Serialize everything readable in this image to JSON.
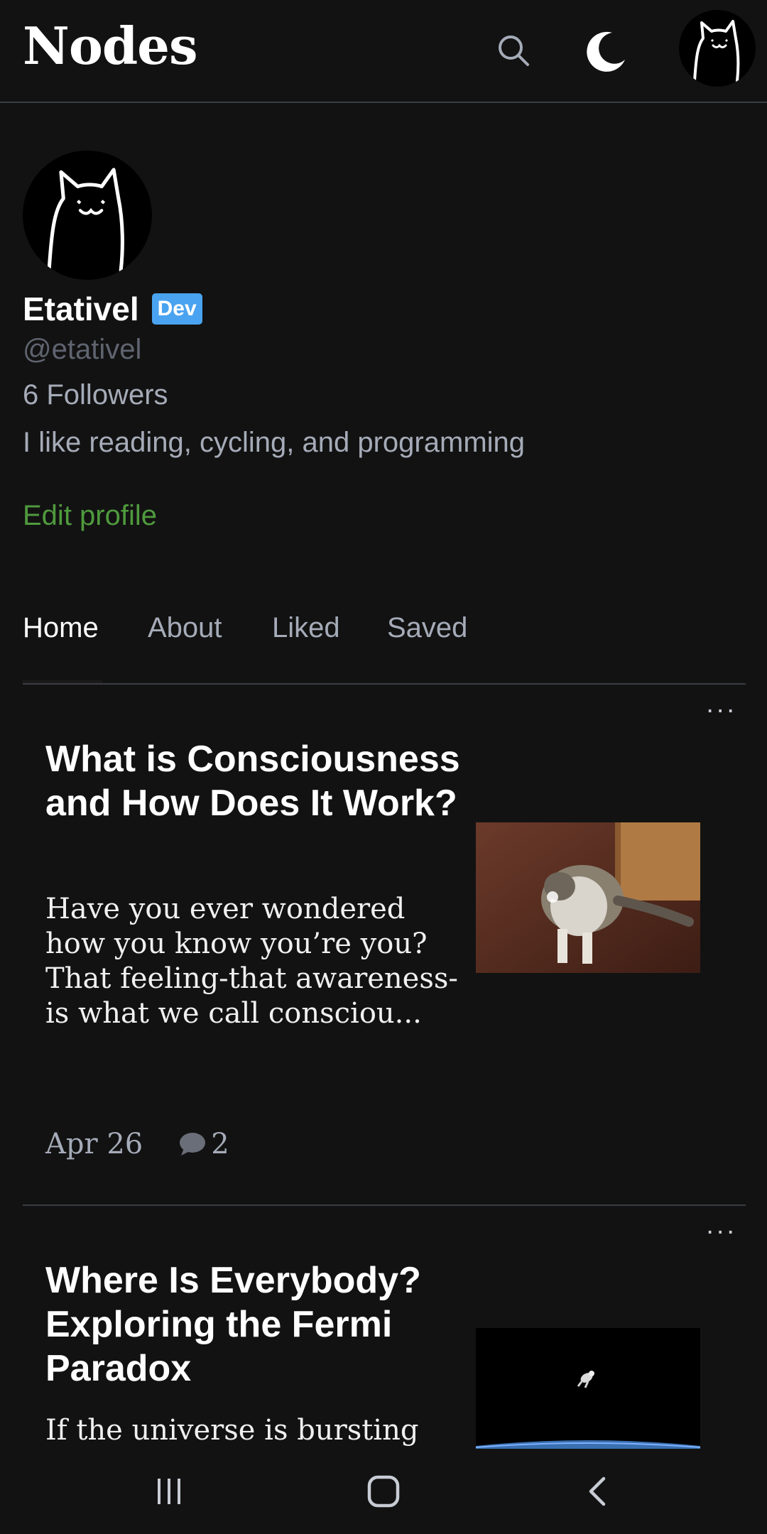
{
  "app": {
    "title": "Nodes"
  },
  "header": {
    "icons": {
      "search": "search-icon",
      "theme": "moon-icon",
      "avatar": "cat-avatar"
    }
  },
  "profile": {
    "name": "Etativel",
    "badge": "Dev",
    "handle": "@etativel",
    "followers": "6 Followers",
    "bio": "I like reading, cycling, and programming",
    "edit_label": "Edit profile"
  },
  "tabs": [
    {
      "label": "Home",
      "active": true
    },
    {
      "label": "About",
      "active": false
    },
    {
      "label": "Liked",
      "active": false
    },
    {
      "label": "Saved",
      "active": false
    }
  ],
  "articles": [
    {
      "title": "What is Consciousness and How Does It Work?",
      "excerpt": "Have you ever wondered how you know you’re you? That feeling-that awareness-is what we call consciou...",
      "date": "Apr 26",
      "comments": "2",
      "more": "...",
      "thumbnail": "cat-photo"
    },
    {
      "title": "Where Is Everybody? Exploring the Fermi Paradox",
      "excerpt": "If the universe is bursting",
      "more": "...",
      "thumbnail": "space-astronaut-photo"
    }
  ],
  "navbar": {
    "icons": [
      "recent-apps-icon",
      "home-icon",
      "back-icon"
    ]
  },
  "colors": {
    "accent_green": "#4f9a3d",
    "badge_blue": "#4aa3f0",
    "background": "#121212"
  }
}
